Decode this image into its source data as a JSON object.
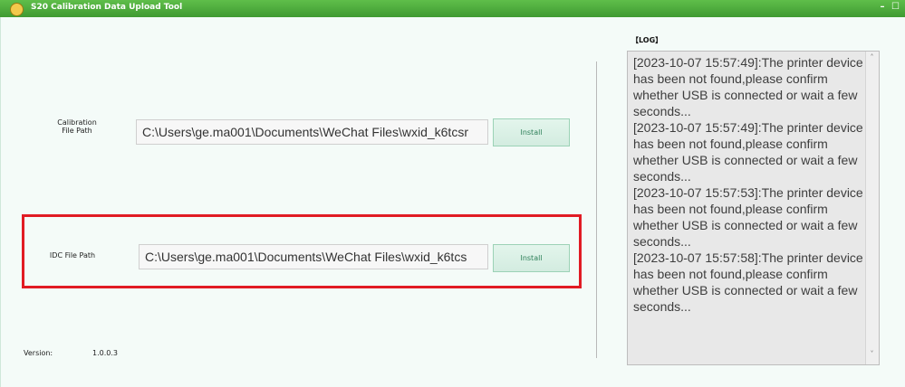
{
  "window": {
    "title": "S20 Calibration Data Upload Tool",
    "controls": "– ☐"
  },
  "calibration": {
    "label_line1": "Calibration",
    "label_line2": "File Path",
    "path_value": "C:\\Users\\ge.ma001\\Documents\\WeChat Files\\wxid_k6tcsr",
    "install_label": "Install"
  },
  "idc": {
    "label": "IDC File Path",
    "path_value": "C:\\Users\\ge.ma001\\Documents\\WeChat Files\\wxid_k6tcs",
    "install_label": "Install"
  },
  "log": {
    "label": "【LOG】",
    "entries": [
      "[2023-10-07 15:57:49]:The printer device has been not found,please confirm whether USB is connected or wait a few seconds...",
      "[2023-10-07 15:57:49]:The printer device has been not found,please confirm whether USB is connected or wait a few seconds...",
      "[2023-10-07 15:57:53]:The printer device has been not found,please confirm whether USB is connected or wait a few seconds...",
      "[2023-10-07 15:57:58]:The printer device has been not found,please confirm whether USB is connected or wait a few seconds..."
    ],
    "scroll_up": "˄",
    "scroll_down": "˅"
  },
  "version": {
    "label": "Version:",
    "value": "1.0.0.3"
  },
  "colors": {
    "titlebar": "#4caf3e",
    "highlight": "#e11b24",
    "install_text": "#2d7f58"
  },
  "icons": {
    "app": "app-logo-icon"
  }
}
